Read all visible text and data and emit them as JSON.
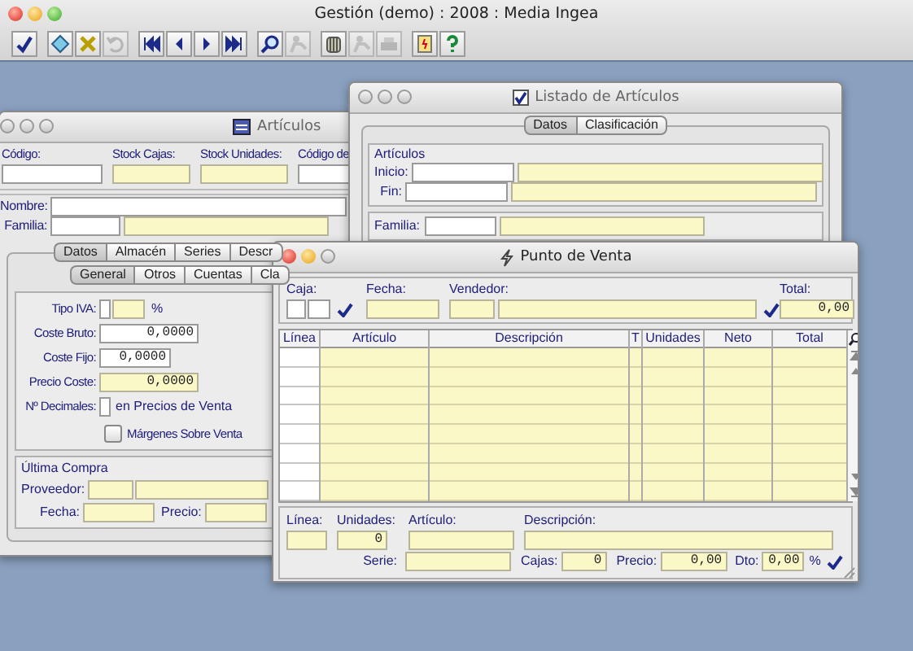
{
  "main_window": {
    "title": "Gestión (demo) : 2008 : Media Ingea",
    "toolbar": [
      [
        {
          "kind": "accept",
          "disabled": false
        }
      ],
      [
        {
          "kind": "edit",
          "disabled": false
        },
        {
          "kind": "delete",
          "disabled": false
        },
        {
          "kind": "undo",
          "disabled": true
        }
      ],
      [
        {
          "kind": "first",
          "disabled": false
        },
        {
          "kind": "prev",
          "disabled": false
        },
        {
          "kind": "next",
          "disabled": false
        },
        {
          "kind": "last",
          "disabled": false
        }
      ],
      [
        {
          "kind": "search",
          "disabled": false
        },
        {
          "kind": "person",
          "disabled": true
        }
      ],
      [
        {
          "kind": "binder",
          "disabled": false
        },
        {
          "kind": "person",
          "disabled": true
        },
        {
          "kind": "print",
          "disabled": true
        }
      ],
      [
        {
          "kind": "note",
          "disabled": false
        },
        {
          "kind": "help",
          "disabled": false
        }
      ]
    ]
  },
  "articulos": {
    "title": "Artículos",
    "active": false,
    "top_fields": [
      {
        "label": "Código:",
        "readonly": false
      },
      {
        "label": "Stock Cajas:",
        "readonly": true
      },
      {
        "label": "Stock Unidades:",
        "readonly": true
      },
      {
        "label": "Código de",
        "readonly": false
      }
    ],
    "nombre_label": "Nombre:",
    "familia_label": "Familia:",
    "tabs": [
      {
        "label": "Datos",
        "selected": true
      },
      {
        "label": "Almacén",
        "selected": false
      },
      {
        "label": "Series",
        "selected": false
      },
      {
        "label": "Descr",
        "selected": false
      }
    ],
    "subtabs": [
      {
        "label": "General",
        "selected": true
      },
      {
        "label": "Otros",
        "selected": false
      },
      {
        "label": "Cuentas",
        "selected": false
      },
      {
        "label": "Cla",
        "selected": false
      }
    ],
    "form": [
      {
        "kind": "iva",
        "label": "Tipo IVA:",
        "suffix": "%"
      },
      {
        "kind": "number",
        "label": "Coste Bruto:",
        "value": "0,0000",
        "readonly": false
      },
      {
        "kind": "short",
        "label": "Coste Fijo:",
        "value": "0,0000",
        "readonly": false
      },
      {
        "kind": "number",
        "label": "Precio Coste:",
        "value": "0,0000",
        "readonly": true
      },
      {
        "kind": "decimals",
        "label": "Nº Decimales:",
        "suffix": "en Precios de Venta"
      }
    ],
    "checkbox": {
      "label": "Márgenes Sobre Venta",
      "checked": false
    },
    "last_purchase": {
      "title": "Última Compra",
      "proveedor_label": "Proveedor:",
      "fecha_label": "Fecha:",
      "precio_label": "Precio:"
    }
  },
  "listado": {
    "title": "Listado de Artículos",
    "active": false,
    "tabs": [
      {
        "label": "Datos",
        "selected": true
      },
      {
        "label": "Clasificación",
        "selected": false
      }
    ],
    "group_title": "Artículos",
    "inicio_label": "Inicio:",
    "fin_label": "Fin:",
    "familia_label": "Familia:"
  },
  "punto": {
    "title": "Punto de Venta",
    "active": true,
    "caja_label": "Caja:",
    "fecha_label": "Fecha:",
    "vendedor_label": "Vendedor:",
    "total_label": "Total:",
    "total_value": "0,00",
    "columns": [
      "Línea",
      "Artículo",
      "Descripción",
      "T",
      "Unidades",
      "Neto",
      "Total"
    ],
    "linea_label": "Línea:",
    "unidades_label": "Unidades:",
    "unidades_value": "0",
    "articulo_label": "Artículo:",
    "descripcion_label": "Descripción:",
    "serie_label": "Serie:",
    "cajas_label": "Cajas:",
    "cajas_value": "0",
    "precio_label": "Precio:",
    "precio_value": "0,00",
    "dto_label": "Dto:",
    "dto_value": "0,00",
    "percent": "%"
  }
}
